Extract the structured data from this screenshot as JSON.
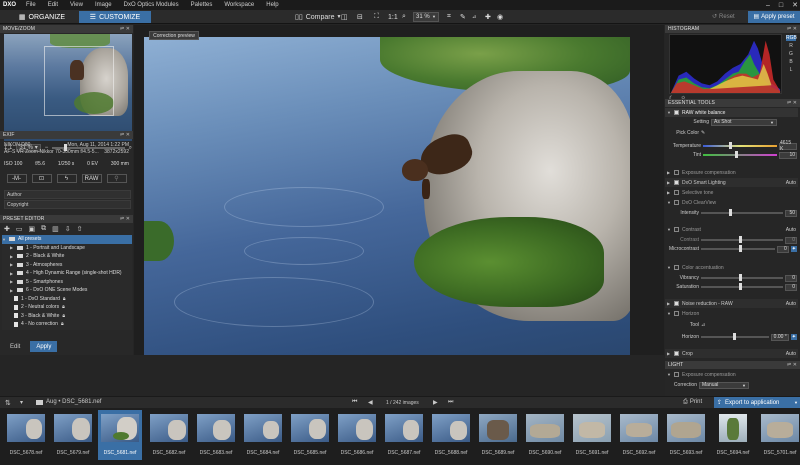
{
  "menubar": {
    "logo": "DXO",
    "items": [
      "File",
      "Edit",
      "View",
      "Image",
      "DxO Optics Modules",
      "Palettes",
      "Workspace",
      "Help"
    ]
  },
  "modes": {
    "organize": "ORGANIZE",
    "customize": "CUSTOMIZE"
  },
  "toolbar": {
    "compare": "Compare",
    "zoom_ratio": "1:1",
    "zoom_pct": "31 %",
    "reset": "Reset",
    "apply_preset": "Apply preset"
  },
  "panels": {
    "move_zoom": "MOVE/ZOOM",
    "exif": "EXIF",
    "preset_editor": "PRESET EDITOR",
    "histogram": "HISTOGRAM",
    "essential_tools": "ESSENTIAL TOOLS",
    "light": "LIGHT"
  },
  "navigator": {
    "ratio": "1:1",
    "zoom": "31 %"
  },
  "exif": {
    "camera": "NIKON D80",
    "date": "Mon, Aug 11, 2014 1:22 PM",
    "lens": "AF-S VR Zoom-Nikkor 70-300mm f/4.5-5...",
    "dims": "3872x2592",
    "iso": "ISO 100",
    "aperture": "f/5.6",
    "shutter": "1/250 s",
    "ev": "0 EV",
    "focal": "300 mm",
    "mode": "-M-",
    "format": "RAW",
    "author_label": "Author",
    "copyright_label": "Copyright"
  },
  "presets": [
    {
      "label": "All presets",
      "level": 0,
      "type": "folder",
      "selected": true
    },
    {
      "label": "1 - Portrait and Landscape",
      "level": 1,
      "type": "folder"
    },
    {
      "label": "2 - Black & White",
      "level": 1,
      "type": "folder"
    },
    {
      "label": "3 - Atmospheres",
      "level": 1,
      "type": "folder"
    },
    {
      "label": "4 - High Dynamic Range (single-shot HDR)",
      "level": 1,
      "type": "folder"
    },
    {
      "label": "5 - Smartphones",
      "level": 1,
      "type": "folder"
    },
    {
      "label": "6 - DxO ONE Scene Modes",
      "level": 1,
      "type": "folder"
    },
    {
      "label": "1 - DxO Standard",
      "level": 1,
      "type": "doc"
    },
    {
      "label": "2 - Neutral colors",
      "level": 1,
      "type": "doc"
    },
    {
      "label": "3 - Black & White",
      "level": 1,
      "type": "doc"
    },
    {
      "label": "4 - No correction",
      "level": 1,
      "type": "doc"
    }
  ],
  "preset_buttons": {
    "edit": "Edit",
    "apply": "Apply"
  },
  "viewer": {
    "corr_tab": "Correction preview"
  },
  "histogram_channels": [
    "RGB",
    "R",
    "G",
    "B",
    "L"
  ],
  "tools": {
    "raw_wb": "RAW white balance",
    "setting_label": "Setting",
    "setting_value": "As Shot",
    "pick_color": "Pick Color",
    "temperature_label": "Temperature",
    "temperature_value": "4615 K",
    "tint_label": "Tint",
    "tint_value": "10",
    "exposure_comp": "Exposure compensation",
    "smart_lighting": "DxO Smart Lighting",
    "auto": "Auto",
    "selective_tone": "Selective tone",
    "clearview": "DxO ClearView",
    "intensity_label": "Intensity",
    "intensity_value": "50",
    "contrast": "Contrast",
    "contrast_label": "Contrast",
    "contrast_value": "0",
    "microcontrast_label": "Microcontrast",
    "microcontrast_value": "0",
    "color_accent": "Color accentuation",
    "vibrancy_label": "Vibrancy",
    "vibrancy_value": "0",
    "saturation_label": "Saturation",
    "saturation_value": "0",
    "noise_reduction": "Noise reduction - RAW",
    "horizon": "Horizon",
    "tool_label": "Tool",
    "horizon_label": "Horizon",
    "horizon_value": "0.00 °",
    "crop": "Crop",
    "exposure_comp2": "Exposure compensation",
    "correction_label": "Correction",
    "correction_value": "Manual"
  },
  "bottombar": {
    "breadcrumb": "Aug • DSC_5681.nef",
    "count": "1 / 242 images",
    "print": "Print",
    "export": "Export to application"
  },
  "filmstrip": [
    {
      "name": "DSC_5678.nef"
    },
    {
      "name": "DSC_5679.nef"
    },
    {
      "name": "DSC_5681.nef",
      "selected": true
    },
    {
      "name": "DSC_5682.nef"
    },
    {
      "name": "DSC_5683.nef"
    },
    {
      "name": "DSC_5684.nef"
    },
    {
      "name": "DSC_5685.nef"
    },
    {
      "name": "DSC_5686.nef"
    },
    {
      "name": "DSC_5687.nef"
    },
    {
      "name": "DSC_5688.nef"
    },
    {
      "name": "DSC_5689.nef"
    },
    {
      "name": "DSC_5690.nef"
    },
    {
      "name": "DSC_5691.nef"
    },
    {
      "name": "DSC_5692.nef"
    },
    {
      "name": "DSC_5693.nef"
    },
    {
      "name": "DSC_5694.nef"
    },
    {
      "name": "DSC_5701.nef"
    }
  ],
  "colors": {
    "accent": "#3a6fa5",
    "panel": "#282828",
    "header": "#3a3a3a"
  }
}
